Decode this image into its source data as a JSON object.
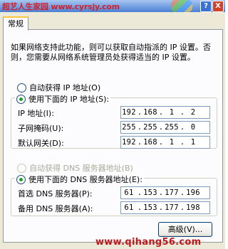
{
  "watermark_top": "超艺人生家园 www.cyrsjy.com",
  "watermark_bottom": "www.qihang56.com",
  "tab": {
    "label": "常规"
  },
  "description": "如果网络支持此功能，则可以获取自动指派的 IP 设置。否则，您需要从网络系统管理员处获得适当的 IP 设置。",
  "ip_section": {
    "auto_label": "自动获得 IP 地址(O)",
    "auto_checked": false,
    "manual_label": "使用下面的 IP 地址(S):",
    "manual_checked": true,
    "fields": [
      {
        "label": "IP 地址(I):",
        "octets": [
          "192",
          "168",
          "1",
          "2"
        ]
      },
      {
        "label": "子网掩码(U):",
        "octets": [
          "255",
          "255",
          "255",
          "0"
        ]
      },
      {
        "label": "默认网关(D):",
        "octets": [
          "192",
          "168",
          "1",
          "1"
        ]
      }
    ]
  },
  "dns_section": {
    "auto_label": "自动获得 DNS 服务器地址(B)",
    "auto_disabled": true,
    "manual_label": "使用下面的 DNS 服务器地址(E):",
    "manual_checked": true,
    "fields": [
      {
        "label": "首选 DNS 服务器(P):",
        "octets": [
          "61",
          "153",
          "177",
          "196"
        ]
      },
      {
        "label": "备用 DNS 服务器(A):",
        "octets": [
          "61",
          "153",
          "177",
          "198"
        ]
      }
    ]
  },
  "advanced_button": "高级(V)...",
  "title_buttons": [
    "?",
    "X"
  ],
  "colors": {
    "accent_tab": "#ffc83c",
    "watermark": "#d3202a",
    "radio_checked": "#21a121"
  }
}
